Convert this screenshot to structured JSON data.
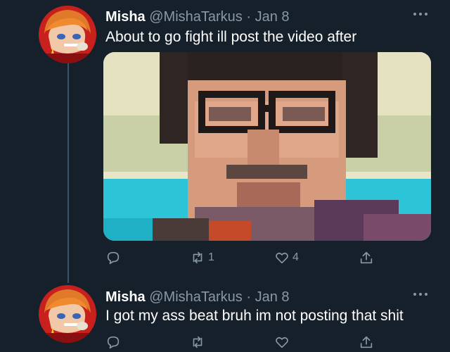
{
  "tweets": [
    {
      "display_name": "Misha",
      "handle": "@MishaTarkus",
      "separator": " · ",
      "date": "Jan 8",
      "text": "About to go fight ill post the video after",
      "has_media": true,
      "actions": {
        "reply_count": "",
        "retweet_count": "1",
        "like_count": "4"
      }
    },
    {
      "display_name": "Misha",
      "handle": "@MishaTarkus",
      "separator": " · ",
      "date": "Jan 8",
      "text": "I got my ass beat bruh im not posting that shit",
      "has_media": false,
      "actions": {
        "reply_count": "",
        "retweet_count": "",
        "like_count": ""
      }
    }
  ],
  "icons": {
    "more": "more-horizontal-icon",
    "reply": "reply-icon",
    "retweet": "retweet-icon",
    "like": "like-icon",
    "share": "share-icon"
  },
  "colors": {
    "background": "#15202b",
    "text_primary": "#ffffff",
    "text_secondary": "#8899a6",
    "thread_line": "#3d5466"
  }
}
